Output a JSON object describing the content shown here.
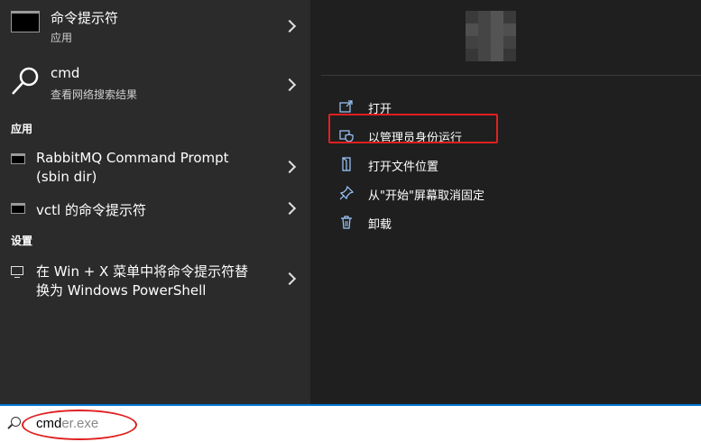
{
  "best_match": {
    "title": "命令提示符",
    "subtitle": "应用"
  },
  "web_search": {
    "title": "cmd",
    "subtitle": "查看网络搜索结果"
  },
  "apps_section": {
    "label": "应用",
    "items": [
      {
        "title_line1": "RabbitMQ Command Prompt",
        "title_line2": "(sbin dir)"
      },
      {
        "title_line1": "vctl 的命令提示符"
      }
    ]
  },
  "settings_section": {
    "label": "设置",
    "items": [
      {
        "title_line1": "在 Win + X 菜单中将命令提示符替",
        "title_line2": "换为 Windows PowerShell"
      }
    ]
  },
  "context_menu": {
    "items": [
      {
        "label": "打开",
        "icon": "open-icon"
      },
      {
        "label": "以管理员身份运行",
        "icon": "shield-icon"
      },
      {
        "label": "打开文件位置",
        "icon": "file-location-icon"
      },
      {
        "label": "从\"开始\"屏幕取消固定",
        "icon": "unpin-icon"
      },
      {
        "label": "卸载",
        "icon": "trash-icon"
      }
    ]
  },
  "search": {
    "typed": "cmd",
    "suggestion": "er.exe"
  },
  "colors": {
    "accent": "#0078d7",
    "annotation": "#e02020"
  }
}
